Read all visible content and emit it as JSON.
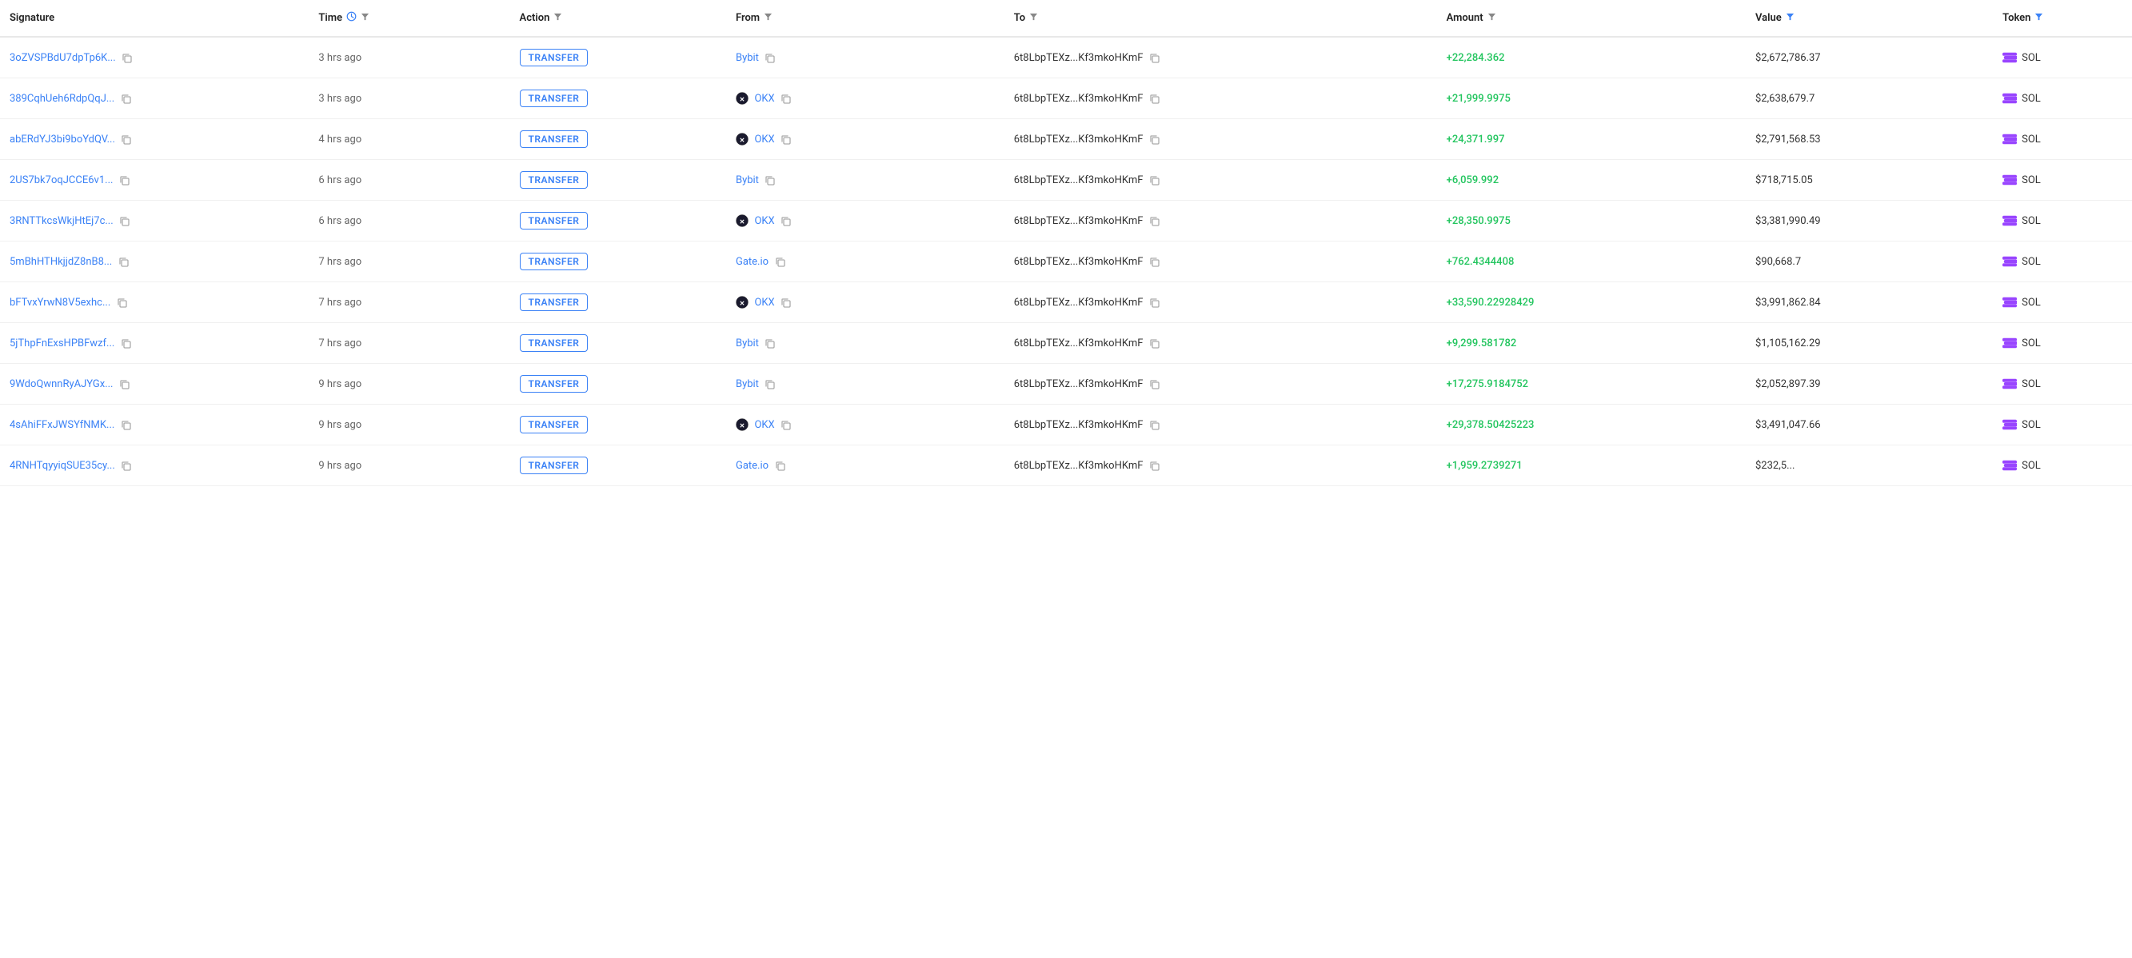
{
  "columns": [
    {
      "id": "signature",
      "label": "Signature",
      "filter": false,
      "clock": false
    },
    {
      "id": "time",
      "label": "Time",
      "filter": true,
      "clock": true
    },
    {
      "id": "action",
      "label": "Action",
      "filter": true,
      "clock": false
    },
    {
      "id": "from",
      "label": "From",
      "filter": true,
      "clock": false
    },
    {
      "id": "to",
      "label": "To",
      "filter": true,
      "clock": false
    },
    {
      "id": "amount",
      "label": "Amount",
      "filter": true,
      "clock": false
    },
    {
      "id": "value",
      "label": "Value",
      "filter": true,
      "clock": false,
      "active": true
    },
    {
      "id": "token",
      "label": "Token",
      "filter": true,
      "clock": false,
      "active": true
    }
  ],
  "rows": [
    {
      "signature": "3oZVSPBdU7dpTp6K...",
      "time": "3 hrs ago",
      "action": "TRANSFER",
      "from": "Bybit",
      "from_type": "named",
      "to": "6t8LbpTEXz...Kf3mkoHKmF",
      "amount": "+22,284.362",
      "value": "$2,672,786.37",
      "token": "SOL"
    },
    {
      "signature": "389CqhUeh6RdpQqJ...",
      "time": "3 hrs ago",
      "action": "TRANSFER",
      "from": "OKX",
      "from_type": "exchange",
      "to": "6t8LbpTEXz...Kf3mkoHKmF",
      "amount": "+21,999.9975",
      "value": "$2,638,679.7",
      "token": "SOL"
    },
    {
      "signature": "abERdYJ3bi9boYdQV...",
      "time": "4 hrs ago",
      "action": "TRANSFER",
      "from": "OKX",
      "from_type": "exchange",
      "to": "6t8LbpTEXz...Kf3mkoHKmF",
      "amount": "+24,371.997",
      "value": "$2,791,568.53",
      "token": "SOL"
    },
    {
      "signature": "2US7bk7oqJCCE6v1...",
      "time": "6 hrs ago",
      "action": "TRANSFER",
      "from": "Bybit",
      "from_type": "named",
      "to": "6t8LbpTEXz...Kf3mkoHKmF",
      "amount": "+6,059.992",
      "value": "$718,715.05",
      "token": "SOL"
    },
    {
      "signature": "3RNTTkcsWkjHtEj7c...",
      "time": "6 hrs ago",
      "action": "TRANSFER",
      "from": "OKX",
      "from_type": "exchange",
      "to": "6t8LbpTEXz...Kf3mkoHKmF",
      "amount": "+28,350.9975",
      "value": "$3,381,990.49",
      "token": "SOL"
    },
    {
      "signature": "5mBhHTHkjjdZ8nB8...",
      "time": "7 hrs ago",
      "action": "TRANSFER",
      "from": "Gate.io",
      "from_type": "named",
      "to": "6t8LbpTEXz...Kf3mkoHKmF",
      "amount": "+762.4344408",
      "value": "$90,668.7",
      "token": "SOL"
    },
    {
      "signature": "bFTvxYrwN8V5exhc...",
      "time": "7 hrs ago",
      "action": "TRANSFER",
      "from": "OKX",
      "from_type": "exchange",
      "to": "6t8LbpTEXz...Kf3mkoHKmF",
      "amount": "+33,590.22928429",
      "value": "$3,991,862.84",
      "token": "SOL"
    },
    {
      "signature": "5jThpFnExsHPBFwzf...",
      "time": "7 hrs ago",
      "action": "TRANSFER",
      "from": "Bybit",
      "from_type": "named",
      "to": "6t8LbpTEXz...Kf3mkoHKmF",
      "amount": "+9,299.581782",
      "value": "$1,105,162.29",
      "token": "SOL"
    },
    {
      "signature": "9WdoQwnnRyAJYGx...",
      "time": "9 hrs ago",
      "action": "TRANSFER",
      "from": "Bybit",
      "from_type": "named",
      "to": "6t8LbpTEXz...Kf3mkoHKmF",
      "amount": "+17,275.9184752",
      "value": "$2,052,897.39",
      "token": "SOL"
    },
    {
      "signature": "4sAhiFFxJWSYfNMK...",
      "time": "9 hrs ago",
      "action": "TRANSFER",
      "from": "OKX",
      "from_type": "exchange",
      "to": "6t8LbpTEXz...Kf3mkoHKmF",
      "amount": "+29,378.50425223",
      "value": "$3,491,047.66",
      "token": "SOL"
    },
    {
      "signature": "4RNHTqyyiqSUE35cy...",
      "time": "9 hrs ago",
      "action": "TRANSFER",
      "from": "Gate.io",
      "from_type": "named",
      "to": "6t8LbpTEXz...Kf3mkoHKmF",
      "amount": "+1,959.2739271",
      "value": "$232,5...",
      "token": "SOL"
    }
  ]
}
